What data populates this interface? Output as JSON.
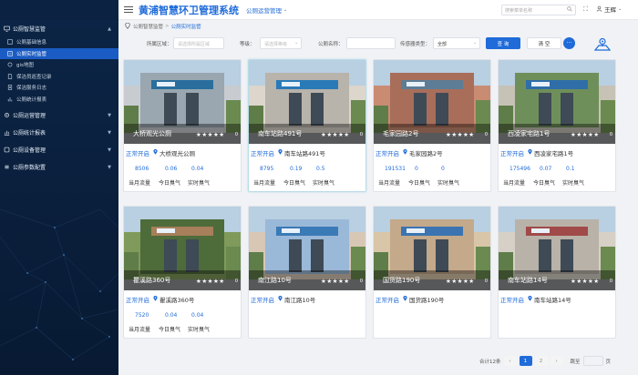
{
  "header": {
    "system_title": "黄浦智慧环卫管理系统",
    "module": "公厕运营管理",
    "search_placeholder": "搜索菜单名称",
    "user": "王辉"
  },
  "sidebar": {
    "groups": [
      {
        "label": "公厕智慧监管",
        "icon": "monitor-icon",
        "expanded": true,
        "items": [
          {
            "label": "公厕基础信息",
            "active": false
          },
          {
            "label": "公厕实时监管",
            "active": true
          },
          {
            "label": "gis地图",
            "active": false
          },
          {
            "label": "保洁员巡查记录",
            "active": false
          },
          {
            "label": "保洁服务日志",
            "active": false
          },
          {
            "label": "公厕统计报表",
            "active": false
          }
        ]
      },
      {
        "label": "公厕运营管理",
        "icon": "settings-icon"
      },
      {
        "label": "公厕统计报表",
        "icon": "chart-icon"
      },
      {
        "label": "公厕设备管理",
        "icon": "device-icon"
      },
      {
        "label": "公厕参数配置",
        "icon": "config-icon"
      }
    ]
  },
  "breadcrumb": [
    "公厕智慧监管",
    "公厕实时监管"
  ],
  "filters": {
    "area_label": "所属区域：",
    "area_placeholder": "请选择所属区域",
    "level_label": "等级：",
    "level_placeholder": "请选择等级",
    "name_label": "公厕名称：",
    "name_value": "",
    "sensor_label": "传感器类型：",
    "sensor_value": "全部",
    "query_label": "查 询",
    "reset_label": "清 空",
    "more_label": "···"
  },
  "cards": [
    {
      "name": "大桥观光公厕",
      "status": "正常开启",
      "address": "大桥观光公厕",
      "stars": "★★★★★",
      "score": "0",
      "flow": "8506",
      "smell_today": "0.06",
      "smell_now": "0.04",
      "highlight": false
    },
    {
      "name": "南车站路491号",
      "status": "正常开启",
      "address": "南车站路491号",
      "stars": "★★★★★",
      "score": "0",
      "flow": "8795",
      "smell_today": "0.19",
      "smell_now": "0.5",
      "highlight": true
    },
    {
      "name": "毛家园路2号",
      "status": "正常开启",
      "address": "毛家园路2号",
      "stars": "★★★★★",
      "score": "0",
      "flow": "191531",
      "smell_today": "0",
      "smell_now": "0",
      "highlight": false
    },
    {
      "name": "西凌家宅路1号",
      "status": "正常开启",
      "address": "西凌家宅路1号",
      "stars": "★★★★★",
      "score": "0",
      "flow": "175496",
      "smell_today": "0.07",
      "smell_now": "0.1",
      "highlight": false
    },
    {
      "name": "瞿溪路360号",
      "status": "正常开启",
      "address": "瞿溪路360号",
      "stars": "★★★★★",
      "score": "0",
      "flow": "7520",
      "smell_today": "0.04",
      "smell_now": "0.04",
      "highlight": false
    },
    {
      "name": "南江路10号",
      "status": "正常开启",
      "address": "南江路10号",
      "stars": "★★★★★",
      "score": "0",
      "flow": "",
      "smell_today": "",
      "smell_now": "",
      "highlight": false
    },
    {
      "name": "国货路190号",
      "status": "正常开启",
      "address": "国货路190号",
      "stars": "★★★★★",
      "score": "0",
      "flow": "",
      "smell_today": "",
      "smell_now": "",
      "highlight": false
    },
    {
      "name": "南车站路14号",
      "status": "正常开启",
      "address": "南车站路14号",
      "stars": "★★★★★",
      "score": "0",
      "flow": "",
      "smell_today": "",
      "smell_now": "",
      "highlight": false
    }
  ],
  "card_labels": {
    "flow": "当月流量",
    "smell_today": "今日臭气",
    "smell_now": "实时臭气"
  },
  "pagination": {
    "total_text": "合计12条",
    "pages": [
      "1",
      "2"
    ],
    "current": "1",
    "prev": "‹",
    "next": "›",
    "goto_label": "跳至",
    "page_suffix": "页"
  },
  "colors": {
    "primary": "#1f6bd9",
    "sidebar_bg": "#0c2546",
    "active_menu": "#1b5cc4"
  }
}
